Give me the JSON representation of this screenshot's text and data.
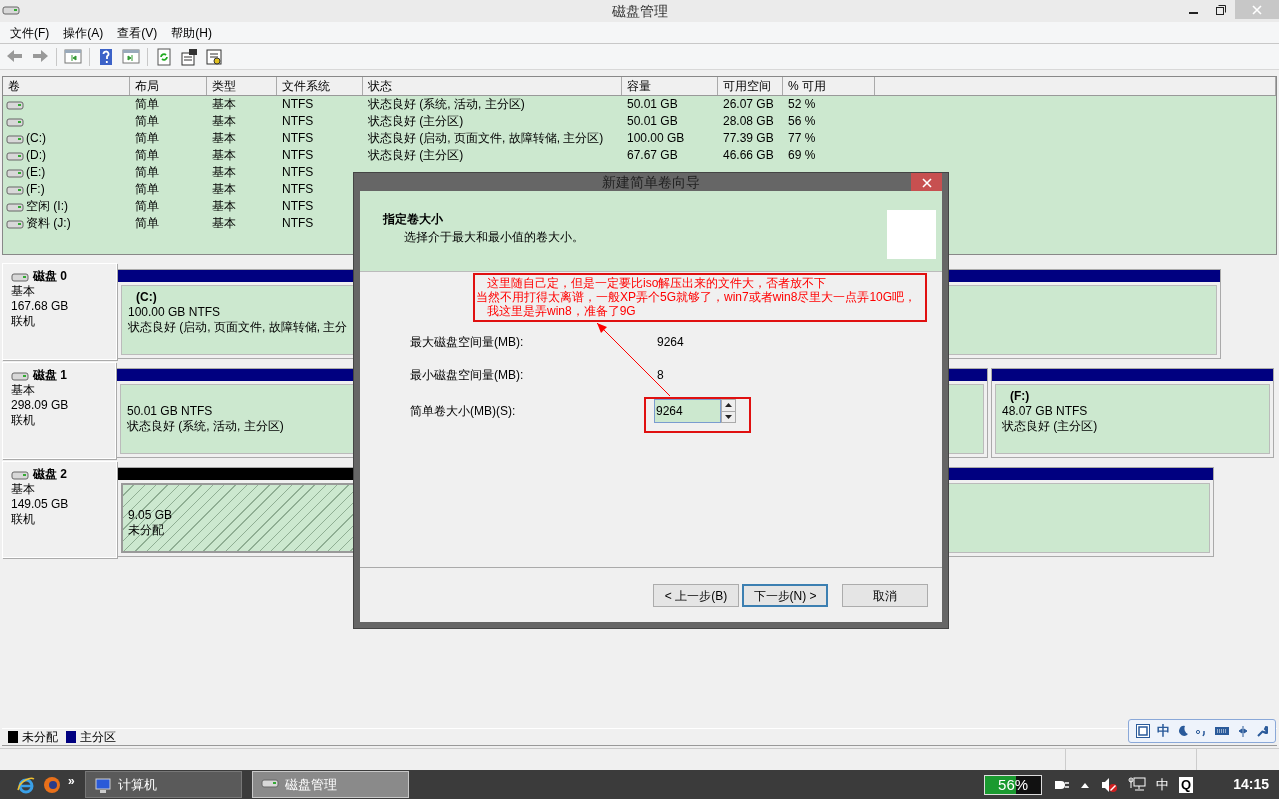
{
  "window": {
    "title": "磁盘管理"
  },
  "menu": [
    "文件(F)",
    "操作(A)",
    "查看(V)",
    "帮助(H)"
  ],
  "table": {
    "columns": [
      "卷",
      "布局",
      "类型",
      "文件系统",
      "状态",
      "容量",
      "可用空间",
      "% 可用"
    ],
    "rows": [
      {
        "cells": [
          "",
          "简单",
          "基本",
          "NTFS",
          "状态良好 (系统, 活动, 主分区)",
          "50.01 GB",
          "26.07 GB",
          "52 %"
        ]
      },
      {
        "cells": [
          "",
          "简单",
          "基本",
          "NTFS",
          "状态良好 (主分区)",
          "50.01 GB",
          "28.08 GB",
          "56 %"
        ]
      },
      {
        "cells": [
          "(C:)",
          "简单",
          "基本",
          "NTFS",
          "状态良好 (启动, 页面文件, 故障转储, 主分区)",
          "100.00 GB",
          "77.39 GB",
          "77 %"
        ]
      },
      {
        "cells": [
          "(D:)",
          "简单",
          "基本",
          "NTFS",
          "状态良好 (主分区)",
          "67.67 GB",
          "46.66 GB",
          "69 %"
        ]
      },
      {
        "cells": [
          "(E:)",
          "简单",
          "基本",
          "NTFS"
        ]
      },
      {
        "cells": [
          "(F:)",
          "简单",
          "基本",
          "NTFS"
        ]
      },
      {
        "cells": [
          "空闲 (I:)",
          "简单",
          "基本",
          "NTFS"
        ]
      },
      {
        "cells": [
          "资料 (J:)",
          "简单",
          "基本",
          "NTFS"
        ]
      }
    ]
  },
  "disks": [
    {
      "name": "磁盘 0",
      "type": "基本",
      "size": "167.68 GB",
      "state": "联机",
      "partitions": [
        {
          "kind": "primary",
          "label": "(C:)",
          "size": "100.00 GB NTFS",
          "status": "状态良好 (启动, 页面文件, 故障转储, 主分"
        }
      ]
    },
    {
      "name": "磁盘 1",
      "type": "基本",
      "size": "298.09 GB",
      "state": "联机",
      "partitions": [
        {
          "kind": "primary",
          "size": "50.01 GB NTFS",
          "status": "状态良好 (系统, 活动, 主分区)"
        },
        {
          "kind": "primary",
          "label": "(F:)",
          "size": "48.07 GB NTFS",
          "status": "状态良好 (主分区)"
        }
      ]
    },
    {
      "name": "磁盘 2",
      "type": "基本",
      "size": "149.05 GB",
      "state": "联机",
      "partitions": [
        {
          "kind": "unallocated",
          "size": "9.05 GB",
          "status": "未分配"
        },
        {
          "kind": "primary"
        }
      ]
    }
  ],
  "legend": [
    {
      "label": "未分配",
      "color": "#000000"
    },
    {
      "label": "主分区",
      "color": "#000080"
    }
  ],
  "dialog": {
    "title": "新建简单卷向导",
    "heading": "指定卷大小",
    "subheading": "选择介于最大和最小值的卷大小。",
    "fields": [
      {
        "label": "最大磁盘空间量(MB):",
        "value": "9264"
      },
      {
        "label": "最小磁盘空间量(MB):",
        "value": "8"
      }
    ],
    "size_field": {
      "label": "简单卷大小(MB)(S):",
      "value": "9264"
    },
    "buttons": [
      {
        "label": "< 上一步(B)",
        "default": false
      },
      {
        "label": "下一步(N) >",
        "default": true
      },
      {
        "label": "取消",
        "default": false
      }
    ]
  },
  "annotation": {
    "lines": [
      "这里随自己定，但是一定要比iso解压出来的文件大，否者放不下",
      "当然不用打得太离谱，一般XP弄个5G就够了，win7或者win8尽里大一点弄10G吧，",
      "我这里是弄win8，准备了9G"
    ]
  },
  "ime_bar": {
    "mode": "中"
  },
  "taskbar": {
    "more": "»",
    "tasks": [
      {
        "label": "计算机",
        "selected": false
      },
      {
        "label": "磁盘管理",
        "selected": true
      }
    ],
    "battery": {
      "label": "56%",
      "level": 0.56
    },
    "ime": "中",
    "q": "Q",
    "clock": "14:15"
  }
}
